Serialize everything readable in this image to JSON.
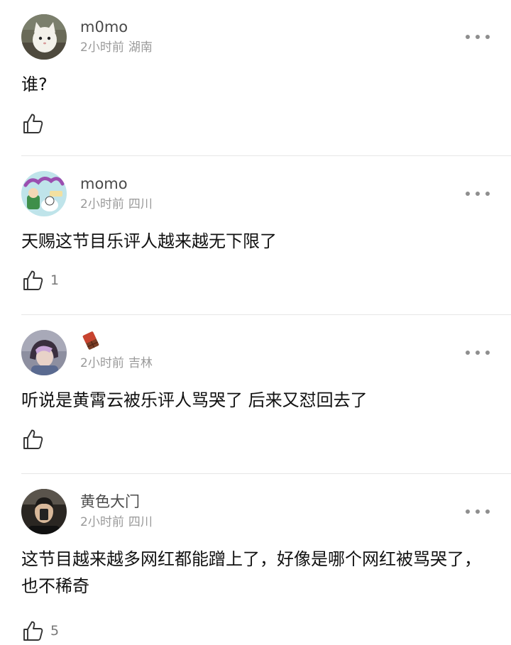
{
  "comments": [
    {
      "username": "m0mo",
      "time": "2小时前",
      "location": "湖南",
      "text": "谁?",
      "likes": "",
      "avatar": "cat-avatar"
    },
    {
      "username": "momo",
      "time": "2小时前",
      "location": "四川",
      "text": "天赐这节目乐评人越来越无下限了",
      "likes": "1",
      "avatar": "cartoon-avatar"
    },
    {
      "username": "",
      "username_emoji": "chocolate-bar-emoji",
      "time": "2小时前",
      "location": "吉林",
      "text": "听说是黄霄云被乐评人骂哭了 后来又怼回去了",
      "likes": "",
      "avatar": "person-avatar"
    },
    {
      "username": "黄色大门",
      "time": "2小时前",
      "location": "四川",
      "text": "这节目越来越多网红都能蹭上了，好像是哪个网红被骂哭了，也不稀奇",
      "likes": "5",
      "avatar": "selfie-avatar"
    }
  ],
  "icons": {
    "like": "thumbs-up-icon",
    "more": "more-dots-icon"
  },
  "colors": {
    "username": "#4a4a4a",
    "meta": "#9a9a9a",
    "text": "#111111",
    "divider": "#e6e6e6"
  }
}
